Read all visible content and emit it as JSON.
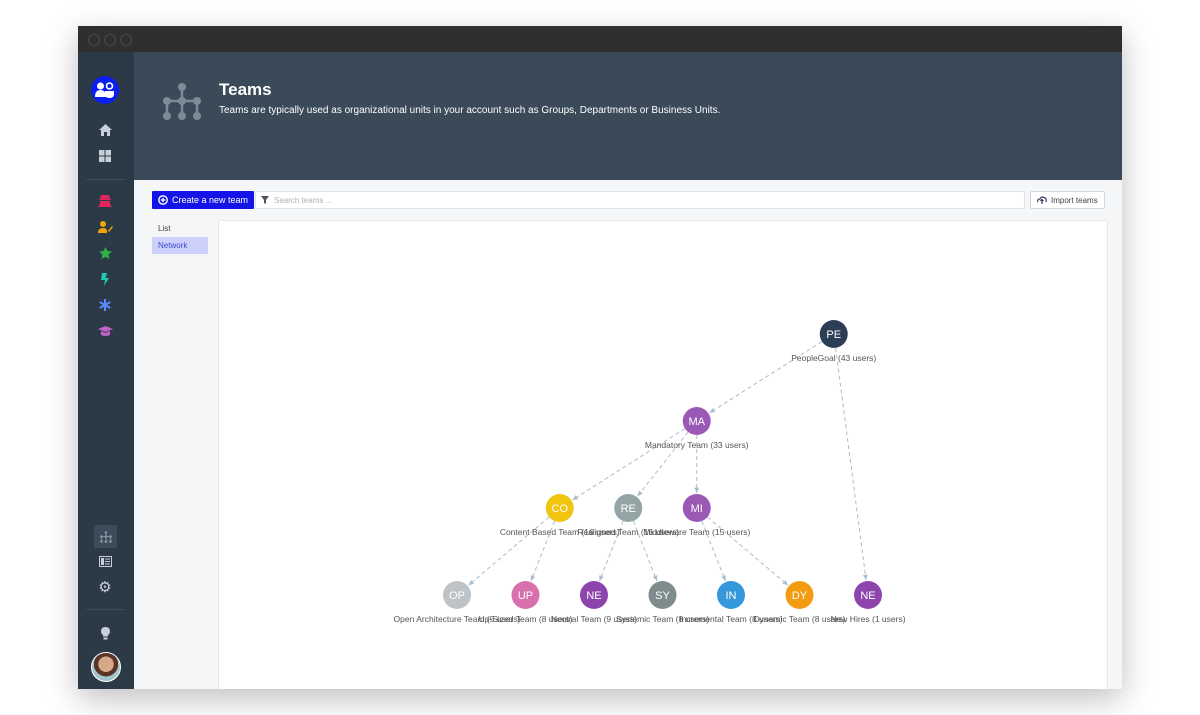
{
  "header": {
    "title": "Teams",
    "description": "Teams are typically used as organizational units in your account such as Groups, Departments or Business Units."
  },
  "toolbar": {
    "create_label": "Create a new team",
    "search_placeholder": "Search teams ...",
    "import_label": "Import teams"
  },
  "view_tabs": [
    {
      "label": "List",
      "active": false
    },
    {
      "label": "Network",
      "active": true
    }
  ],
  "sidebar": {
    "top_icons": [
      "home-icon",
      "dashboard-icon"
    ],
    "app_icons": [
      {
        "name": "spy-icon",
        "color": "#e0245e"
      },
      {
        "name": "user-edit-icon",
        "color": "#f0a500"
      },
      {
        "name": "star-icon",
        "color": "#2fb344"
      },
      {
        "name": "bolt-icon",
        "color": "#1fc8b0"
      },
      {
        "name": "asterisk-icon",
        "color": "#5b8cff"
      },
      {
        "name": "graduation-cap-icon",
        "color": "#c162c9"
      }
    ],
    "bottom_icons": [
      "org-chart-icon",
      "table-icon",
      "gear-icon",
      "lightbulb-icon",
      "bell-icon"
    ]
  },
  "network": {
    "nodes": [
      {
        "id": "pe",
        "initials": "PE",
        "label": "PeopleGoal (43 users)",
        "color": "#2c3e55",
        "level": 0,
        "col": 5.5
      },
      {
        "id": "ma",
        "initials": "MA",
        "label": "Mandatory Team (33 users)",
        "color": "#9b59b6",
        "level": 1,
        "col": 3.5
      },
      {
        "id": "co",
        "initials": "CO",
        "label": "Content Based Team (16 users)",
        "color": "#f1c40f",
        "level": 2,
        "col": 1.5
      },
      {
        "id": "re",
        "initials": "RE",
        "label": "Realigned Team (16 users)",
        "color": "#95a5a6",
        "level": 2,
        "col": 2.5
      },
      {
        "id": "mi",
        "initials": "MI",
        "label": "Middleware Team (15 users)",
        "color": "#9b59b6",
        "level": 2,
        "col": 3.5
      },
      {
        "id": "op",
        "initials": "OP",
        "label": "Open Architecture Team (5 users)",
        "color": "#bdc3c7",
        "level": 3,
        "col": 0
      },
      {
        "id": "up",
        "initials": "UP",
        "label": "Up-Sized Team (8 users)",
        "color": "#d770ad",
        "level": 3,
        "col": 1
      },
      {
        "id": "ne1",
        "initials": "NE",
        "label": "Neutral Team (9 users)",
        "color": "#8e44ad",
        "level": 3,
        "col": 2
      },
      {
        "id": "sy",
        "initials": "SY",
        "label": "Systemic Team (8 users)",
        "color": "#7f8c8d",
        "level": 3,
        "col": 3
      },
      {
        "id": "in",
        "initials": "IN",
        "label": "Incremental Team (8 users)",
        "color": "#3498db",
        "level": 3,
        "col": 4
      },
      {
        "id": "dy",
        "initials": "DY",
        "label": "Dynamic Team (8 users)",
        "color": "#f39c12",
        "level": 3,
        "col": 5
      },
      {
        "id": "ne2",
        "initials": "NE",
        "label": "New Hires (1 users)",
        "color": "#8e44ad",
        "level": 3,
        "col": 6
      }
    ],
    "edges": [
      [
        "pe",
        "ma"
      ],
      [
        "pe",
        "ne2"
      ],
      [
        "ma",
        "co"
      ],
      [
        "ma",
        "re"
      ],
      [
        "ma",
        "mi"
      ],
      [
        "co",
        "op"
      ],
      [
        "co",
        "up"
      ],
      [
        "re",
        "ne1"
      ],
      [
        "re",
        "sy"
      ],
      [
        "mi",
        "in"
      ],
      [
        "mi",
        "dy"
      ]
    ]
  }
}
